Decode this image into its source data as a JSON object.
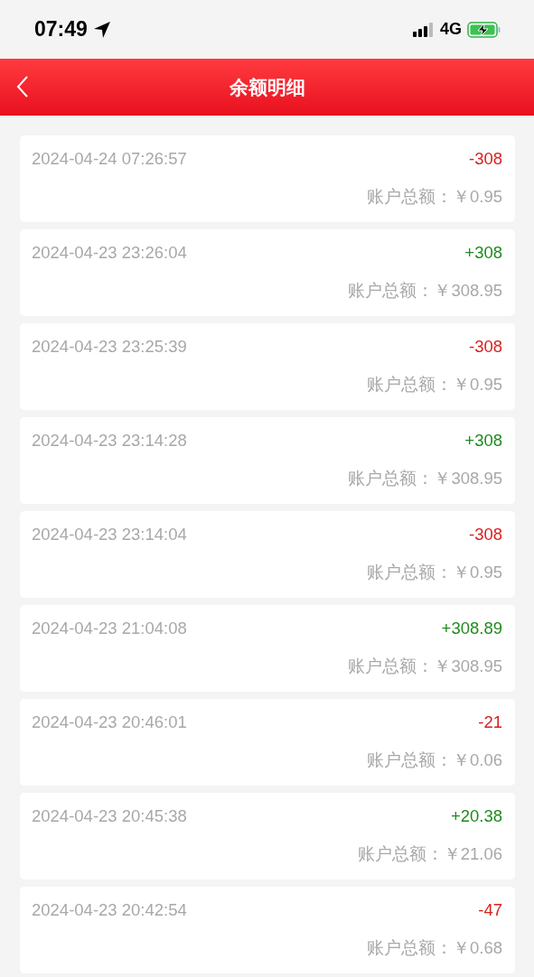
{
  "status_bar": {
    "time": "07:49",
    "network": "4G"
  },
  "header": {
    "title": "余额明细"
  },
  "records": [
    {
      "time": "2024-04-24 07:26:57",
      "amount": "-308",
      "kind": "debit",
      "balance": "账户总额：￥0.95"
    },
    {
      "time": "2024-04-23 23:26:04",
      "amount": "+308",
      "kind": "credit",
      "balance": "账户总额：￥308.95"
    },
    {
      "time": "2024-04-23 23:25:39",
      "amount": "-308",
      "kind": "debit",
      "balance": "账户总额：￥0.95"
    },
    {
      "time": "2024-04-23 23:14:28",
      "amount": "+308",
      "kind": "credit",
      "balance": "账户总额：￥308.95"
    },
    {
      "time": "2024-04-23 23:14:04",
      "amount": "-308",
      "kind": "debit",
      "balance": "账户总额：￥0.95"
    },
    {
      "time": "2024-04-23 21:04:08",
      "amount": "+308.89",
      "kind": "credit",
      "balance": "账户总额：￥308.95"
    },
    {
      "time": "2024-04-23 20:46:01",
      "amount": "-21",
      "kind": "debit",
      "balance": "账户总额：￥0.06"
    },
    {
      "time": "2024-04-23 20:45:38",
      "amount": "+20.38",
      "kind": "credit",
      "balance": "账户总额：￥21.06"
    },
    {
      "time": "2024-04-23 20:42:54",
      "amount": "-47",
      "kind": "debit",
      "balance": "账户总额：￥0.68"
    }
  ]
}
